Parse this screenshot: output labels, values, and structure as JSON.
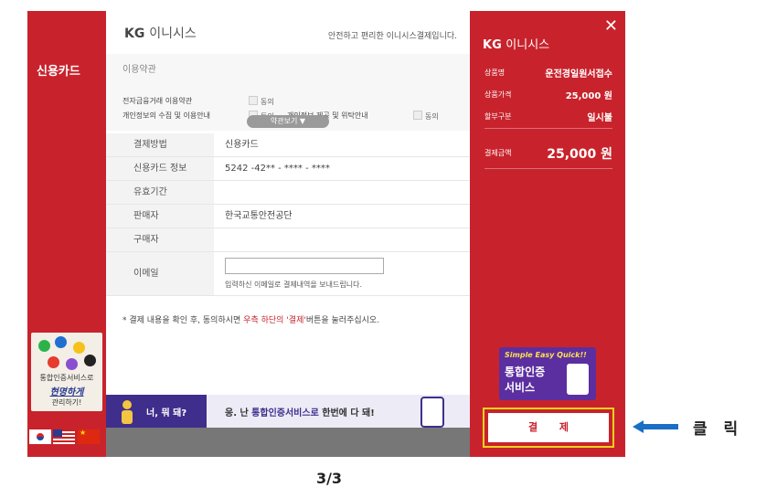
{
  "left": {
    "title": "신용카드",
    "cert_ad": {
      "line1": "통합인증서비스로",
      "line2": "현명하게",
      "line3": "관리하기!"
    },
    "flags": [
      "kr-flag-icon",
      "us-flag-icon",
      "cn-flag-icon"
    ]
  },
  "header": {
    "brand": "KG",
    "brand_sub": "이니시스",
    "tagline": "안전하고 편리한 이니시스결제입니다."
  },
  "terms": {
    "title": "이용약관",
    "row1": "전자금융거래 이용약관",
    "row2": "개인정보의 수집 및 이용안내",
    "row2b": "개인정보 제공 및 위탁안내",
    "agree": "동의",
    "view_button": "약관보기 ▼"
  },
  "info": {
    "rows": [
      {
        "label": "결제방법",
        "value": "신용카드"
      },
      {
        "label": "신용카드 정보",
        "value": "5242 -42** - **** - ****"
      },
      {
        "label": "유효기간",
        "value": ""
      },
      {
        "label": "판매자",
        "value": "한국교통안전공단"
      },
      {
        "label": "구매자",
        "value": ""
      }
    ],
    "email_label": "이메일",
    "email_value": "",
    "email_note": "입력하신 이메일로 결제내역을 보내드립니다."
  },
  "notice": {
    "prefix": "* 결제 내용을 확인 후, 동의하시면 ",
    "highlight1": "우측 하단의",
    "highlight2": "'결제'",
    "suffix": "버튼을 눌러주십시오."
  },
  "banner": {
    "left_text": "너, 뭐 돼?",
    "right_prefix": "응. 난 ",
    "right_highlight": "통합인증서비스로",
    "right_suffix": " 한번에 다 돼!"
  },
  "summary": {
    "brand": "KG",
    "brand_sub": "이니시스",
    "product_label": "상품명",
    "product_value": "운전경일원서접수",
    "price_label": "상품가격",
    "price_value": "25,000 원",
    "installment_label": "할부구분",
    "installment_value": "일시불",
    "total_label": "결제금액",
    "total_value": "25,000 원"
  },
  "simple_ad": {
    "line1": "Simple Easy Quick!!",
    "line2": "통합인증",
    "line3": "서비스"
  },
  "pay_button": "결 제",
  "annotation": {
    "click_label": "클 릭"
  },
  "page_indicator": "3/3",
  "colors": {
    "primary_red": "#c8232c",
    "banner_purple": "#3f2e8c",
    "highlight_yellow": "#f2d21b",
    "arrow_blue": "#1a6fc4"
  }
}
